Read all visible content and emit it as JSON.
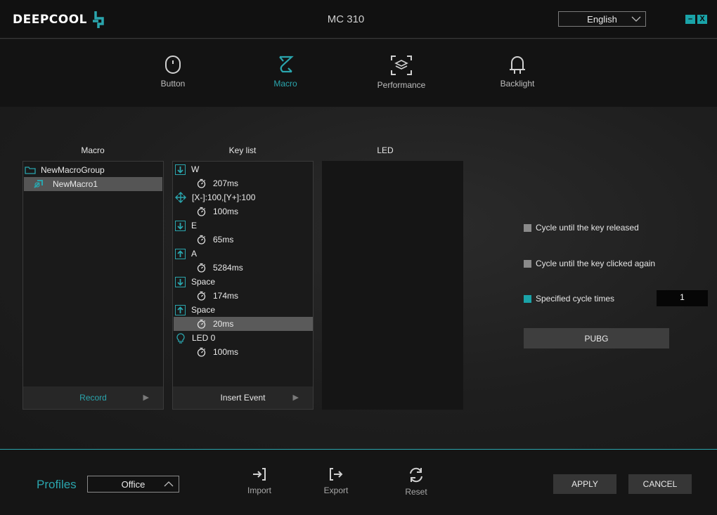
{
  "app": {
    "logo_text": "DEEPCOOL",
    "title": "MC 310",
    "language": "English"
  },
  "window_controls": {
    "minimize": "–",
    "close": "X"
  },
  "nav": {
    "tabs": [
      {
        "label": "Button",
        "icon": "mouse-icon"
      },
      {
        "label": "Macro",
        "icon": "macro-icon",
        "active": true
      },
      {
        "label": "Performance",
        "icon": "performance-icon"
      },
      {
        "label": "Backlight",
        "icon": "backlight-icon"
      }
    ]
  },
  "macro_panel": {
    "header": "Macro",
    "group": "NewMacroGroup",
    "item": "NewMacro1",
    "footer": "Record"
  },
  "keylist_panel": {
    "header": "Key list",
    "footer": "Insert Event",
    "rows": [
      {
        "kind": "key-down",
        "text": "W"
      },
      {
        "kind": "delay",
        "text": "207ms"
      },
      {
        "kind": "move",
        "text": "[X-]:100,[Y+]:100"
      },
      {
        "kind": "delay",
        "text": "100ms"
      },
      {
        "kind": "key-down",
        "text": "E"
      },
      {
        "kind": "delay",
        "text": "65ms"
      },
      {
        "kind": "key-up",
        "text": "A"
      },
      {
        "kind": "delay",
        "text": "5284ms"
      },
      {
        "kind": "key-down",
        "text": "Space"
      },
      {
        "kind": "delay",
        "text": "174ms"
      },
      {
        "kind": "key-up",
        "text": "Space"
      },
      {
        "kind": "delay",
        "text": "20ms",
        "selected": true
      },
      {
        "kind": "led",
        "text": "LED 0"
      },
      {
        "kind": "delay",
        "text": "100ms"
      }
    ]
  },
  "led_panel": {
    "header": "LED"
  },
  "options": {
    "cycle_released": "Cycle until the key released",
    "cycle_clicked": "Cycle until the key clicked again",
    "specified": "Specified cycle times",
    "cycle_count": "1",
    "pubg_label": "PUBG"
  },
  "bottom": {
    "profiles_label": "Profiles",
    "profile_value": "Office",
    "import": "Import",
    "export": "Export",
    "reset": "Reset",
    "apply": "APPLY",
    "cancel": "CANCEL"
  },
  "colors": {
    "accent": "#2aa5ad",
    "background": "#1c1c1c"
  }
}
